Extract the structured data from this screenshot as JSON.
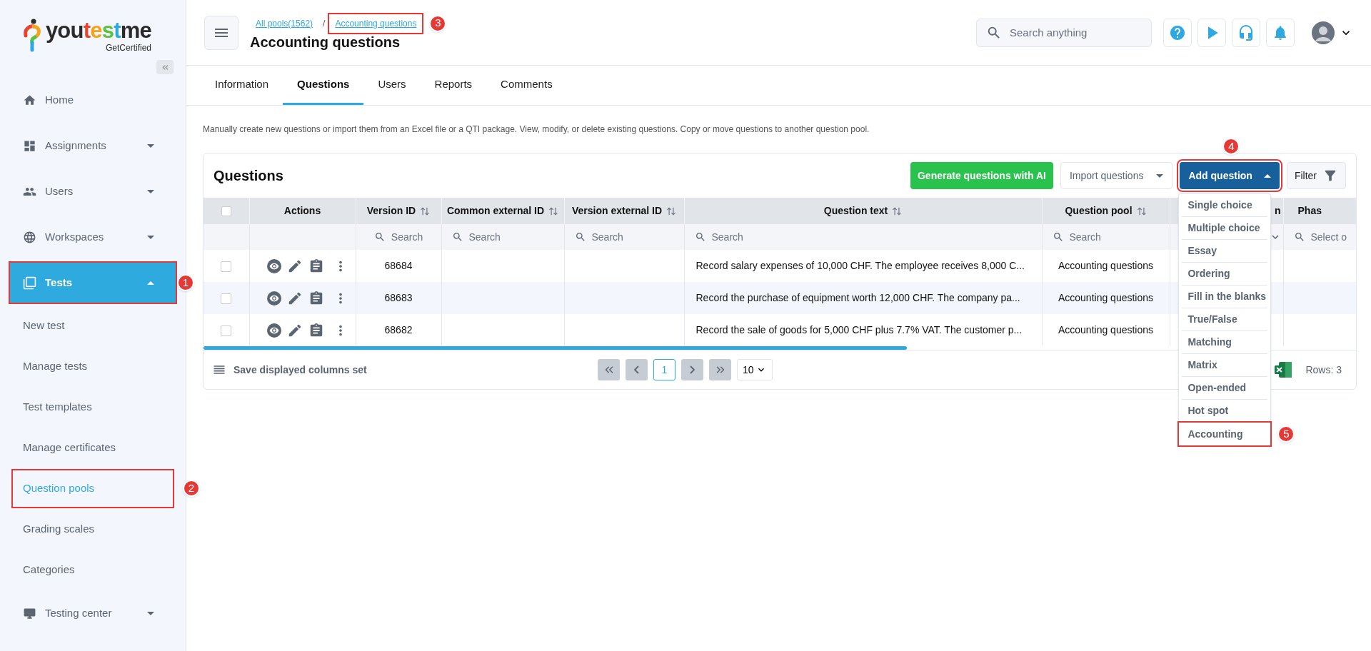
{
  "sidebar": {
    "logo": {
      "parts": [
        {
          "text": "you",
          "color": "#2b2b2b"
        },
        {
          "text": "t",
          "color": "#e8452c"
        },
        {
          "text": "e",
          "color": "#f7a21b"
        },
        {
          "text": "s",
          "color": "#5cc043"
        },
        {
          "text": "t",
          "color": "#2ea8e0"
        },
        {
          "text": "me",
          "color": "#2b2b2b"
        }
      ],
      "tagline": "GetCertified"
    },
    "items": [
      {
        "label": "Home",
        "selected": false
      },
      {
        "label": "Assignments",
        "expanded": false,
        "selected": false
      },
      {
        "label": "Users",
        "expanded": false,
        "selected": false
      },
      {
        "label": "Workspaces",
        "expanded": false,
        "selected": false
      },
      {
        "label": "Tests",
        "expanded": true,
        "selected": true,
        "callout": "1",
        "children": [
          {
            "label": "New test",
            "selected": false
          },
          {
            "label": "Manage tests",
            "selected": false
          },
          {
            "label": "Test templates",
            "selected": false
          },
          {
            "label": "Manage certificates",
            "selected": false
          },
          {
            "label": "Question pools",
            "selected": true,
            "callout": "2"
          },
          {
            "label": "Grading scales",
            "selected": false
          },
          {
            "label": "Categories",
            "selected": false
          }
        ]
      },
      {
        "label": "Testing center",
        "expanded": false,
        "selected": false
      }
    ]
  },
  "header": {
    "breadcrumbs": [
      {
        "label": "All pools(1562)"
      },
      {
        "label": "Accounting questions",
        "callout": "3"
      }
    ],
    "separator": "/",
    "title": "Accounting questions",
    "search": {
      "placeholder": "Search anything"
    }
  },
  "tabs": [
    {
      "label": "Information",
      "selected": false
    },
    {
      "label": "Questions",
      "selected": true
    },
    {
      "label": "Users",
      "selected": false
    },
    {
      "label": "Reports",
      "selected": false
    },
    {
      "label": "Comments",
      "selected": false
    }
  ],
  "description": "Manually create new questions or import them from an Excel file or a QTI package. View, modify, or delete existing questions. Copy or move questions to another question pool.",
  "card": {
    "title": "Questions",
    "buttons": {
      "generate": "Generate questions with AI",
      "import": "Import questions",
      "add": {
        "label": "Add question",
        "callout": "4",
        "expanded": true
      },
      "filter": "Filter"
    },
    "add_menu": [
      {
        "label": "Single choice"
      },
      {
        "label": "Multiple choice"
      },
      {
        "label": "Essay"
      },
      {
        "label": "Ordering"
      },
      {
        "label": "Fill in the blanks"
      },
      {
        "label": "True/False"
      },
      {
        "label": "Matching"
      },
      {
        "label": "Matrix"
      },
      {
        "label": "Open-ended"
      },
      {
        "label": "Hot spot"
      },
      {
        "label": "Accounting",
        "callout": "5"
      }
    ],
    "table": {
      "select_all": {
        "checked": false
      },
      "columns": [
        {
          "kind": "check"
        },
        {
          "kind": "actions",
          "label": "Actions"
        },
        {
          "kind": "text",
          "label": "Version ID",
          "sortable": true,
          "search": "Search"
        },
        {
          "kind": "text",
          "label": "Common external ID",
          "sortable": true,
          "search": "Search"
        },
        {
          "kind": "text",
          "label": "Version external ID",
          "sortable": true,
          "search": "Search"
        },
        {
          "kind": "text",
          "label": "Question text",
          "sortable": true,
          "search": "Search"
        },
        {
          "kind": "text",
          "label": "Question pool",
          "sortable": true,
          "search": "Search"
        },
        {
          "kind": "select",
          "label": "n"
        },
        {
          "kind": "select",
          "label": "Phas",
          "search": "Select o"
        }
      ],
      "rows": [
        {
          "checked": false,
          "cells": [
            "68684",
            "",
            "",
            "Record salary expenses of 10,000 CHF. The employee receives 8,000 C...",
            "Accounting questions"
          ]
        },
        {
          "checked": false,
          "cells": [
            "68683",
            "",
            "",
            "Record the purchase of equipment worth 12,000 CHF. The company pa...",
            "Accounting questions"
          ]
        },
        {
          "checked": false,
          "cells": [
            "68682",
            "",
            "",
            "Record the sale of goods for 5,000 CHF plus 7.7% VAT. The customer p...",
            "Accounting questions"
          ]
        }
      ]
    },
    "footer": {
      "save_columns": "Save displayed columns set",
      "page": "1",
      "page_size": "10",
      "rows": "Rows: 3"
    }
  }
}
